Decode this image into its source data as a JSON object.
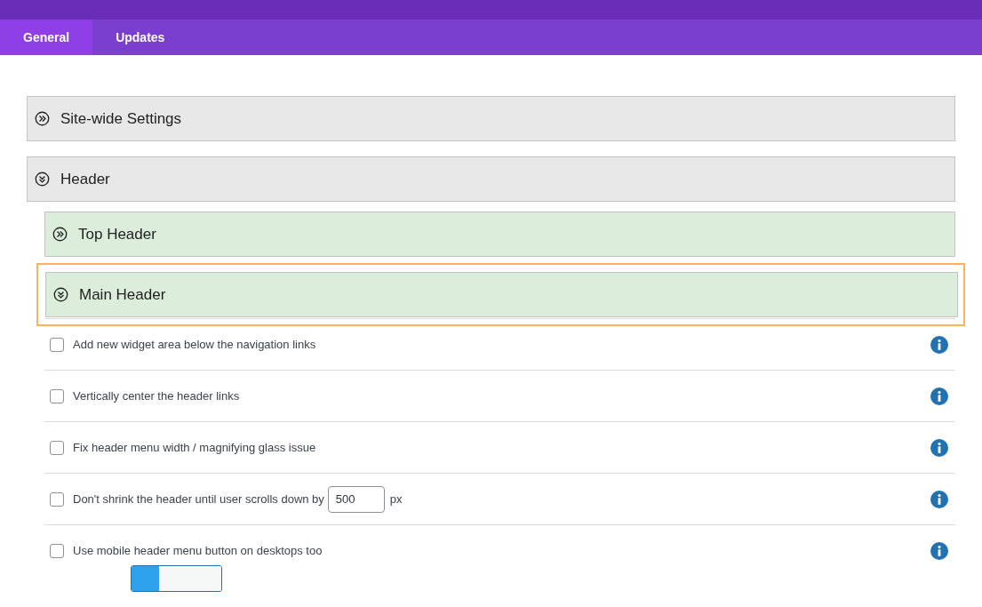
{
  "tabs": [
    {
      "label": "General",
      "selected": true
    },
    {
      "label": "Updates",
      "selected": false
    }
  ],
  "sections": [
    {
      "title": "Site-wide Settings",
      "expanded": false
    },
    {
      "title": "Header",
      "expanded": true,
      "children": [
        {
          "title": "Top Header",
          "expanded": false,
          "highlighted": false
        },
        {
          "title": "Main Header",
          "expanded": true,
          "highlighted": true
        }
      ]
    }
  ],
  "options": [
    {
      "kind": "checkbox",
      "label": "Add new widget area below the navigation links",
      "checked": false
    },
    {
      "kind": "checkbox",
      "label": "Vertically center the header links",
      "checked": false
    },
    {
      "kind": "checkbox",
      "label": "Fix header menu width / magnifying glass issue",
      "checked": false
    },
    {
      "kind": "number",
      "label": "Don't shrink the header until user scrolls down by",
      "checked": false,
      "value": "500",
      "unit": "px"
    },
    {
      "kind": "checkbox",
      "label": "Use mobile header menu button on desktops too",
      "checked": false
    }
  ]
}
